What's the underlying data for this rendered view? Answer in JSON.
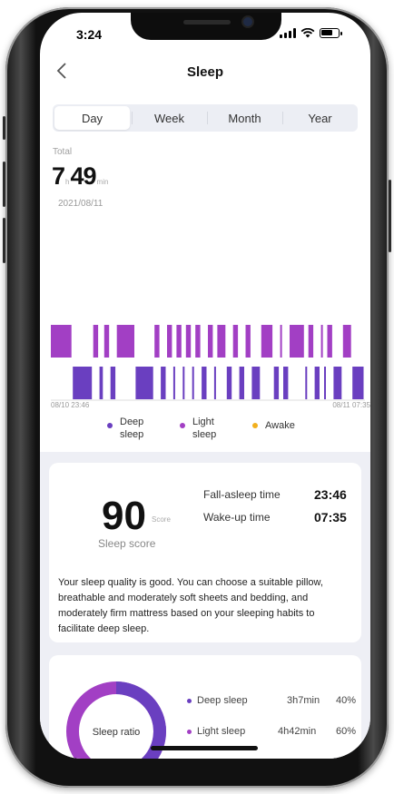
{
  "status": {
    "time": "3:24"
  },
  "header": {
    "title": "Sleep",
    "back_icon": "chevron-left-icon"
  },
  "tabs": [
    {
      "label": "Day",
      "active": true
    },
    {
      "label": "Week",
      "active": false
    },
    {
      "label": "Month",
      "active": false
    },
    {
      "label": "Year",
      "active": false
    }
  ],
  "total": {
    "label": "Total",
    "hours": "7",
    "hours_unit": "h",
    "minutes": "49",
    "minutes_unit": "min",
    "date": "2021/08/11"
  },
  "chart": {
    "start_label": "08/10 23:46",
    "end_label": "08/11 07:35"
  },
  "chart_data": {
    "type": "bar",
    "levels": [
      "light",
      "deep"
    ],
    "segments": [
      {
        "start": 0.0,
        "end": 0.07,
        "stage": "light"
      },
      {
        "start": 0.07,
        "end": 0.135,
        "stage": "deep"
      },
      {
        "start": 0.135,
        "end": 0.155,
        "stage": "light"
      },
      {
        "start": 0.155,
        "end": 0.17,
        "stage": "deep"
      },
      {
        "start": 0.17,
        "end": 0.19,
        "stage": "light"
      },
      {
        "start": 0.19,
        "end": 0.21,
        "stage": "deep"
      },
      {
        "start": 0.21,
        "end": 0.27,
        "stage": "light"
      },
      {
        "start": 0.27,
        "end": 0.33,
        "stage": "deep"
      },
      {
        "start": 0.33,
        "end": 0.35,
        "stage": "light"
      },
      {
        "start": 0.35,
        "end": 0.37,
        "stage": "deep"
      },
      {
        "start": 0.37,
        "end": 0.39,
        "stage": "light"
      },
      {
        "start": 0.39,
        "end": 0.4,
        "stage": "deep"
      },
      {
        "start": 0.4,
        "end": 0.42,
        "stage": "light"
      },
      {
        "start": 0.42,
        "end": 0.43,
        "stage": "deep"
      },
      {
        "start": 0.43,
        "end": 0.45,
        "stage": "light"
      },
      {
        "start": 0.45,
        "end": 0.46,
        "stage": "deep"
      },
      {
        "start": 0.46,
        "end": 0.48,
        "stage": "light"
      },
      {
        "start": 0.48,
        "end": 0.5,
        "stage": "deep"
      },
      {
        "start": 0.5,
        "end": 0.52,
        "stage": "light"
      },
      {
        "start": 0.52,
        "end": 0.53,
        "stage": "deep"
      },
      {
        "start": 0.53,
        "end": 0.56,
        "stage": "light"
      },
      {
        "start": 0.56,
        "end": 0.58,
        "stage": "deep"
      },
      {
        "start": 0.58,
        "end": 0.6,
        "stage": "light"
      },
      {
        "start": 0.6,
        "end": 0.62,
        "stage": "deep"
      },
      {
        "start": 0.62,
        "end": 0.64,
        "stage": "light"
      },
      {
        "start": 0.64,
        "end": 0.67,
        "stage": "deep"
      },
      {
        "start": 0.67,
        "end": 0.71,
        "stage": "light"
      },
      {
        "start": 0.71,
        "end": 0.73,
        "stage": "deep"
      },
      {
        "start": 0.73,
        "end": 0.74,
        "stage": "light"
      },
      {
        "start": 0.74,
        "end": 0.76,
        "stage": "deep"
      },
      {
        "start": 0.76,
        "end": 0.81,
        "stage": "light"
      },
      {
        "start": 0.81,
        "end": 0.82,
        "stage": "deep"
      },
      {
        "start": 0.82,
        "end": 0.84,
        "stage": "light"
      },
      {
        "start": 0.84,
        "end": 0.86,
        "stage": "deep"
      },
      {
        "start": 0.86,
        "end": 0.87,
        "stage": "light"
      },
      {
        "start": 0.87,
        "end": 0.88,
        "stage": "deep"
      },
      {
        "start": 0.88,
        "end": 0.9,
        "stage": "light"
      },
      {
        "start": 0.9,
        "end": 0.93,
        "stage": "deep"
      },
      {
        "start": 0.93,
        "end": 0.96,
        "stage": "light"
      },
      {
        "start": 0.96,
        "end": 1.0,
        "stage": "deep"
      }
    ],
    "colors": {
      "light": "#a23fc4",
      "deep": "#6a3fc0"
    }
  },
  "legend": [
    {
      "label_1": "Deep",
      "label_2": "sleep",
      "color": "#6a3fc0"
    },
    {
      "label_1": "Light",
      "label_2": "sleep",
      "color": "#a23fc4"
    },
    {
      "label_1": "Awake",
      "label_2": "",
      "color": "#f2b01e"
    }
  ],
  "score_card": {
    "score": "90",
    "score_unit": "Score",
    "score_label": "Sleep score",
    "fall_asleep_label": "Fall-asleep time",
    "fall_asleep_value": "23:46",
    "wake_up_label": "Wake-up time",
    "wake_up_value": "07:35",
    "advice": "Your sleep quality is good. You can choose a suitable pillow, breathable and moderately soft sheets and bedding, and moderately firm mattress based on your sleeping habits to facilitate deep sleep."
  },
  "ratio_card": {
    "title": "Sleep ratio",
    "rows": [
      {
        "label": "Deep sleep",
        "duration": "3h7min",
        "percent": "40%",
        "color": "#6a3fc0"
      },
      {
        "label": "Light sleep",
        "duration": "4h42min",
        "percent": "60%",
        "color": "#a23fc4"
      }
    ],
    "deep_fraction": 0.4
  }
}
